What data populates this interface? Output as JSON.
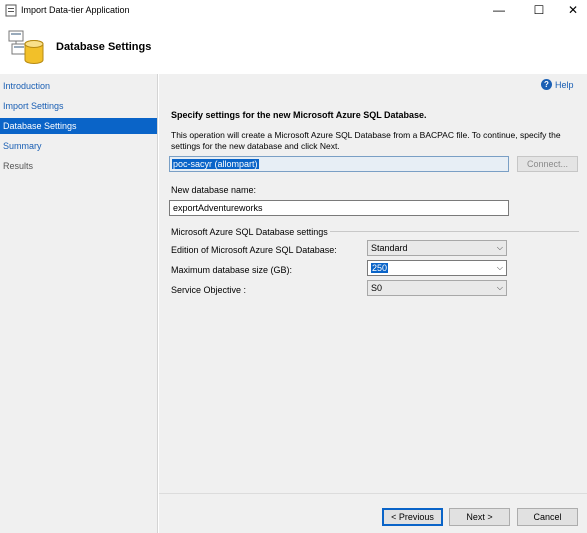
{
  "window": {
    "title": "Import Data-tier Application",
    "controls": {
      "minimize": "—",
      "maximize": "☐",
      "close": "✕"
    }
  },
  "header": {
    "title": "Database Settings",
    "icon": "database-wizard-icon"
  },
  "sidebar": {
    "items": [
      {
        "label": "Introduction",
        "state": "link"
      },
      {
        "label": "Import Settings",
        "state": "link"
      },
      {
        "label": "Database Settings",
        "state": "active"
      },
      {
        "label": "Summary",
        "state": "link"
      },
      {
        "label": "Results",
        "state": "disabled"
      }
    ]
  },
  "main": {
    "help_label": "Help",
    "heading": "Specify settings for the new Microsoft Azure SQL Database.",
    "description": "This operation will create a Microsoft Azure SQL Database from a BACPAC file. To continue, specify the settings for the new database and click Next.",
    "server_value": "poc-sacyr (allompart)",
    "connect_label": "Connect...",
    "db_name_label": "New database name:",
    "db_name_value": "exportAdventureworks",
    "group_label": "Microsoft Azure SQL Database settings",
    "edition_label": "Edition of Microsoft Azure SQL Database:",
    "edition_value": "Standard",
    "maxsize_label": "Maximum database size (GB):",
    "maxsize_value": "250",
    "objective_label": "Service Objective :",
    "objective_value": "S0"
  },
  "buttons": {
    "previous": "< Previous",
    "next": "Next >",
    "cancel": "Cancel"
  }
}
